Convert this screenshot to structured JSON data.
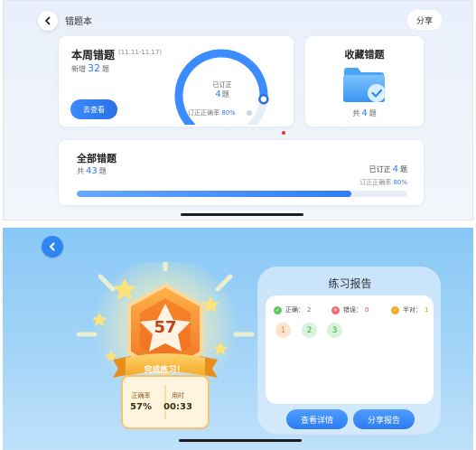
{
  "top": {
    "title": "错题本",
    "share_label": "分享",
    "week": {
      "title": "本周错题",
      "range": "(11.11-11.17)",
      "new_prefix": "新增",
      "new_count": "32",
      "unit": "题",
      "go_label": "去查看",
      "fixed_label": "已订正",
      "fixed_count": "4",
      "rate_prefix": "订正正确率",
      "rate_value": "80%",
      "gauge_fraction": 0.85
    },
    "favorites": {
      "title": "收藏错题",
      "prefix": "共",
      "count": "4",
      "unit": "题"
    },
    "all": {
      "title": "全部错题",
      "prefix": "共",
      "count": "43",
      "unit": "题",
      "fixed_prefix": "已订正",
      "fixed_count": "4",
      "rate_prefix": "订正正确率",
      "rate_value": "80%",
      "progress": 0.83
    }
  },
  "bottom": {
    "score": "57",
    "complete_label": "完成练习！",
    "accuracy_label": "正确率",
    "accuracy_value": "57%",
    "time_label": "用时",
    "time_value": "00:33",
    "report": {
      "title": "练习报告",
      "correct_label": "正确：",
      "correct_count": "2",
      "wrong_label": "错误：",
      "wrong_count": "0",
      "half_label": "半对：",
      "half_count": "1",
      "questions": [
        "1",
        "2",
        "3"
      ],
      "detail_label": "查看详情",
      "share_label": "分享报告"
    }
  },
  "colors": {
    "accent": "#2f7cf6",
    "correct": "#5cc65a",
    "wrong": "#f06a6a",
    "half": "#f5a623"
  },
  "icons": {
    "back": "chevron-left-icon",
    "folder": "folder-check-icon",
    "correct": "check-circle-icon",
    "wrong": "x-circle-icon",
    "half": "half-check-icon"
  }
}
